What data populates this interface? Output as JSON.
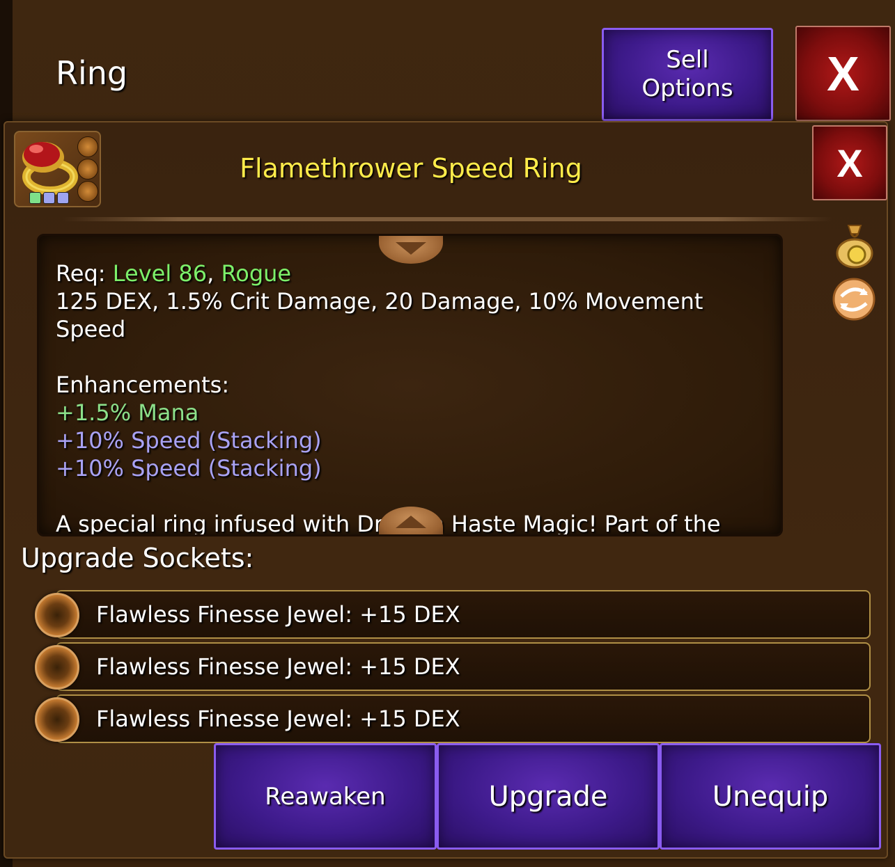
{
  "window": {
    "title": "Ring",
    "sell_label": "Sell Options",
    "close_label": "X"
  },
  "item": {
    "name": "Flamethrower Speed Ring",
    "name_color": "#ffec4a",
    "close_label": "X",
    "icon": "ring-icon",
    "socket_gem_colors": [
      "#7ee08a",
      "#9ea4f0",
      "#9ea4f0"
    ]
  },
  "description": {
    "req_label": "Req:",
    "req_level": "Level 86",
    "req_sep": ",",
    "req_class": "Rogue",
    "stats": "125 DEX, 1.5% Crit Damage, 20 Damage, 10% Movement Speed",
    "enh_label": "Enhancements:",
    "enhancements": [
      {
        "text": "+1.5% Mana",
        "color": "#8ce08a"
      },
      {
        "text": "+10% Speed (Stacking)",
        "color": "#a9a2f4"
      },
      {
        "text": "+10% Speed (Stacking)",
        "color": "#a9a2f4"
      }
    ],
    "flavor": "A special ring infused with Dragkin Haste Magic! Part of the Haste Set"
  },
  "side_icons": [
    "gold-bag-icon",
    "swap-icon"
  ],
  "sockets": {
    "title": "Upgrade Sockets:",
    "items": [
      {
        "label": "Flawless Finesse Jewel: +15 DEX"
      },
      {
        "label": "Flawless Finesse Jewel: +15 DEX"
      },
      {
        "label": "Flawless Finesse Jewel: +15 DEX"
      }
    ]
  },
  "actions": {
    "reawaken": "Reawaken",
    "upgrade": "Upgrade",
    "unequip": "Unequip"
  }
}
